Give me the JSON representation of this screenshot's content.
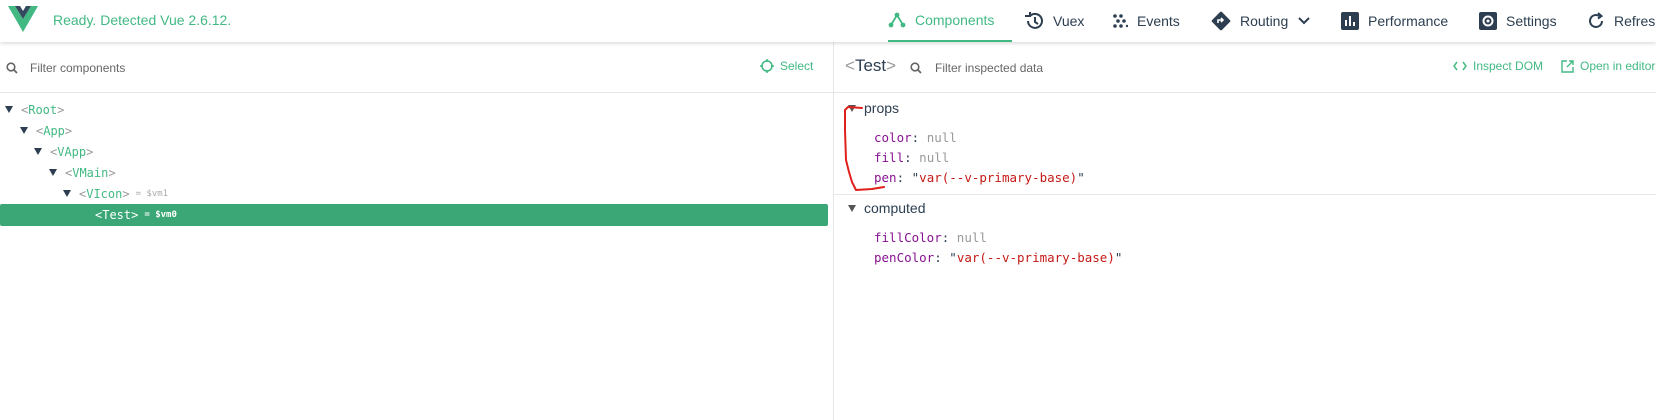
{
  "header": {
    "status": "Ready. Detected Vue 2.6.12.",
    "nav": [
      {
        "label": "Components",
        "icon": "components-icon",
        "active": true
      },
      {
        "label": "Vuex",
        "icon": "history-icon"
      },
      {
        "label": "Events",
        "icon": "events-icon"
      },
      {
        "label": "Routing",
        "icon": "routing-icon"
      },
      {
        "label": "Performance",
        "icon": "performance-icon"
      },
      {
        "label": "Settings",
        "icon": "settings-icon"
      },
      {
        "label": "Refresh",
        "icon": "refresh-icon"
      }
    ]
  },
  "components_pane": {
    "filter_placeholder": "Filter components",
    "select_label": "Select",
    "tree": [
      {
        "name": "Root",
        "depth": 0,
        "expanded": true
      },
      {
        "name": "App",
        "depth": 1,
        "expanded": true
      },
      {
        "name": "VApp",
        "depth": 2,
        "expanded": true
      },
      {
        "name": "VMain",
        "depth": 3,
        "expanded": true
      },
      {
        "name": "VIcon",
        "depth": 4,
        "expanded": true,
        "vm": "= $vm1"
      },
      {
        "name": "Test",
        "depth": 5,
        "selected": true,
        "vm": "= $vm0"
      }
    ]
  },
  "inspector": {
    "component_name": "Test",
    "filter_placeholder": "Filter inspected data",
    "inspect_dom_label": "Inspect DOM",
    "open_editor_label": "Open in editor",
    "sections": [
      {
        "title": "props",
        "items": [
          {
            "key": "color",
            "value": "null",
            "type": "null"
          },
          {
            "key": "fill",
            "value": "null",
            "type": "null"
          },
          {
            "key": "pen",
            "value": "var(--v-primary-base)",
            "type": "string"
          }
        ]
      },
      {
        "title": "computed",
        "items": [
          {
            "key": "fillColor",
            "value": "null",
            "type": "null"
          },
          {
            "key": "penColor",
            "value": "var(--v-primary-base)",
            "type": "string"
          }
        ]
      }
    ]
  },
  "colors": {
    "accent": "#42b983",
    "selected_bg": "#3ba776",
    "prop_key": "#881391",
    "string_value": "#c41a16",
    "annotation": "#e0201b"
  }
}
